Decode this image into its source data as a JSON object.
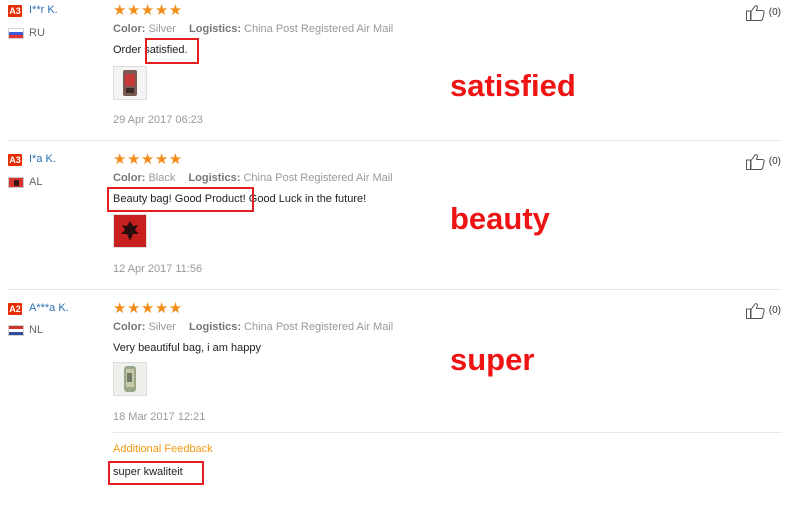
{
  "reviews": [
    {
      "level": "A3",
      "buyer": "I**r K.",
      "country": "RU",
      "stars": "★★★★★",
      "color_label": "Color:",
      "color_value": "Silver",
      "logistics_label": "Logistics:",
      "logistics_value": "China Post Registered Air Mail",
      "text_parts": [
        "Order ",
        "satisfied."
      ],
      "date": "29 Apr 2017 06:23",
      "helpful": "(0)",
      "tag": "satisfied"
    },
    {
      "level": "A3",
      "buyer": "I*a K.",
      "country": "AL",
      "stars": "★★★★★",
      "color_label": "Color:",
      "color_value": "Black",
      "logistics_label": "Logistics:",
      "logistics_value": "China Post Registered Air Mail",
      "text_parts": [
        "Beauty bag! Good Product!",
        " Good Luck in the future!"
      ],
      "date": "12 Apr 2017 11:56",
      "helpful": "(0)",
      "tag": "beauty"
    },
    {
      "level": "A2",
      "buyer": "A***a K.",
      "country": "NL",
      "stars": "★★★★★",
      "color_label": "Color:",
      "color_value": "Silver",
      "logistics_label": "Logistics:",
      "logistics_value": "China Post Registered Air Mail",
      "text_parts": [
        "Very beautiful bag, i am happy"
      ],
      "date": "18 Mar 2017 12:21",
      "helpful": "(0)",
      "tag": "super",
      "additional_feedback_title": "Additional Feedback",
      "additional_feedback_text": "super kwaliteit"
    }
  ],
  "colors": {
    "badge": "#e62e04",
    "stars": "#f28c1a",
    "buyer_link": "#2c6fb3",
    "highlight": "#e41f1f",
    "additional_feedback": "#f39a11"
  },
  "icons": [
    "thumbs-up-icon"
  ]
}
